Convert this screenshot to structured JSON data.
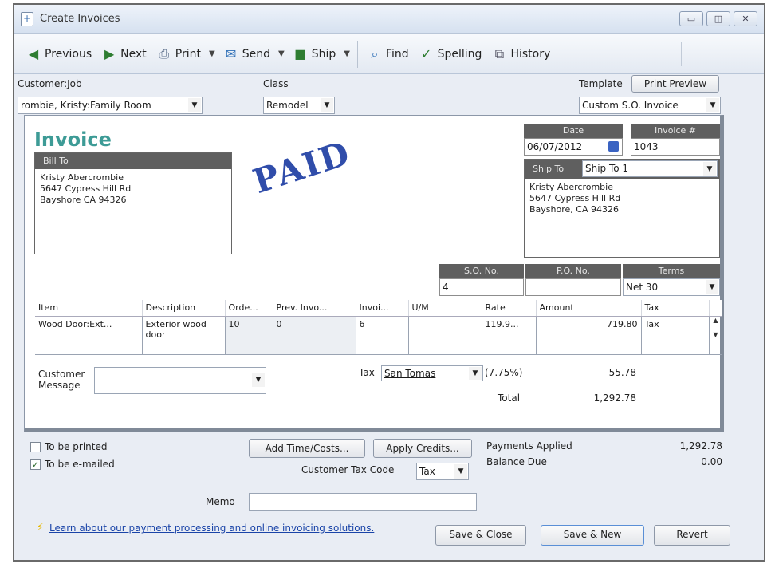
{
  "window": {
    "title": "Create Invoices",
    "controls": [
      "minimize",
      "maximize",
      "close"
    ]
  },
  "toolbar": {
    "previous": "Previous",
    "next": "Next",
    "print": "Print",
    "send": "Send",
    "ship": "Ship",
    "find": "Find",
    "spelling": "Spelling",
    "history": "History"
  },
  "header": {
    "customer_job_label": "Customer:Job",
    "customer_job_value": "rombie, Kristy:Family Room",
    "class_label": "Class",
    "class_value": "Remodel",
    "template_label": "Template",
    "print_preview": "Print Preview",
    "template_value": "Custom S.O. Invoice"
  },
  "invoice": {
    "title": "Invoice",
    "stamp": "PAID",
    "date_label": "Date",
    "date_value": "06/07/2012",
    "invoice_no_label": "Invoice #",
    "invoice_no_value": "1043",
    "bill_to_label": "Bill To",
    "bill_to_lines": [
      "Kristy Abercrombie",
      "5647 Cypress Hill Rd",
      "Bayshore CA 94326"
    ],
    "ship_to_label": "Ship To",
    "ship_to_select": "Ship To 1",
    "ship_to_lines": [
      "Kristy Abercrombie",
      "5647 Cypress Hill Rd",
      "Bayshore, CA 94326"
    ],
    "so_no_label": "S.O. No.",
    "so_no_value": "4",
    "po_no_label": "P.O. No.",
    "po_no_value": "",
    "terms_label": "Terms",
    "terms_value": "Net 30"
  },
  "lines": {
    "columns": [
      "Item",
      "Description",
      "Orde...",
      "Prev. Invo...",
      "Invoi...",
      "U/M",
      "Rate",
      "Amount",
      "Tax"
    ],
    "rows": [
      {
        "item": "Wood Door:Ext...",
        "description": "Exterior wood door",
        "ordered": "10",
        "prev_invoiced": "0",
        "invoiced": "6",
        "um": "",
        "rate": "119.9...",
        "amount": "719.80",
        "tax": "Tax"
      }
    ]
  },
  "footer_invoice": {
    "customer_message_label": "Customer Message",
    "tax_label": "Tax",
    "tax_item": "San Tomas",
    "tax_rate": "(7.75%)",
    "tax_amount": "55.78",
    "total_label": "Total",
    "total_value": "1,292.78"
  },
  "bottom": {
    "to_be_printed": "To be printed",
    "to_be_printed_checked": false,
    "to_be_emailed": "To be e-mailed",
    "to_be_emailed_checked": true,
    "add_time_costs": "Add Time/Costs...",
    "apply_credits": "Apply Credits...",
    "customer_tax_code_label": "Customer Tax Code",
    "customer_tax_code_value": "Tax",
    "payments_applied_label": "Payments Applied",
    "payments_applied_value": "1,292.78",
    "balance_due_label": "Balance Due",
    "balance_due_value": "0.00",
    "memo_label": "Memo",
    "memo_value": "",
    "learn_link": "Learn about our payment processing and online invoicing solutions.",
    "save_close": "Save & Close",
    "save_new": "Save & New",
    "revert": "Revert"
  }
}
